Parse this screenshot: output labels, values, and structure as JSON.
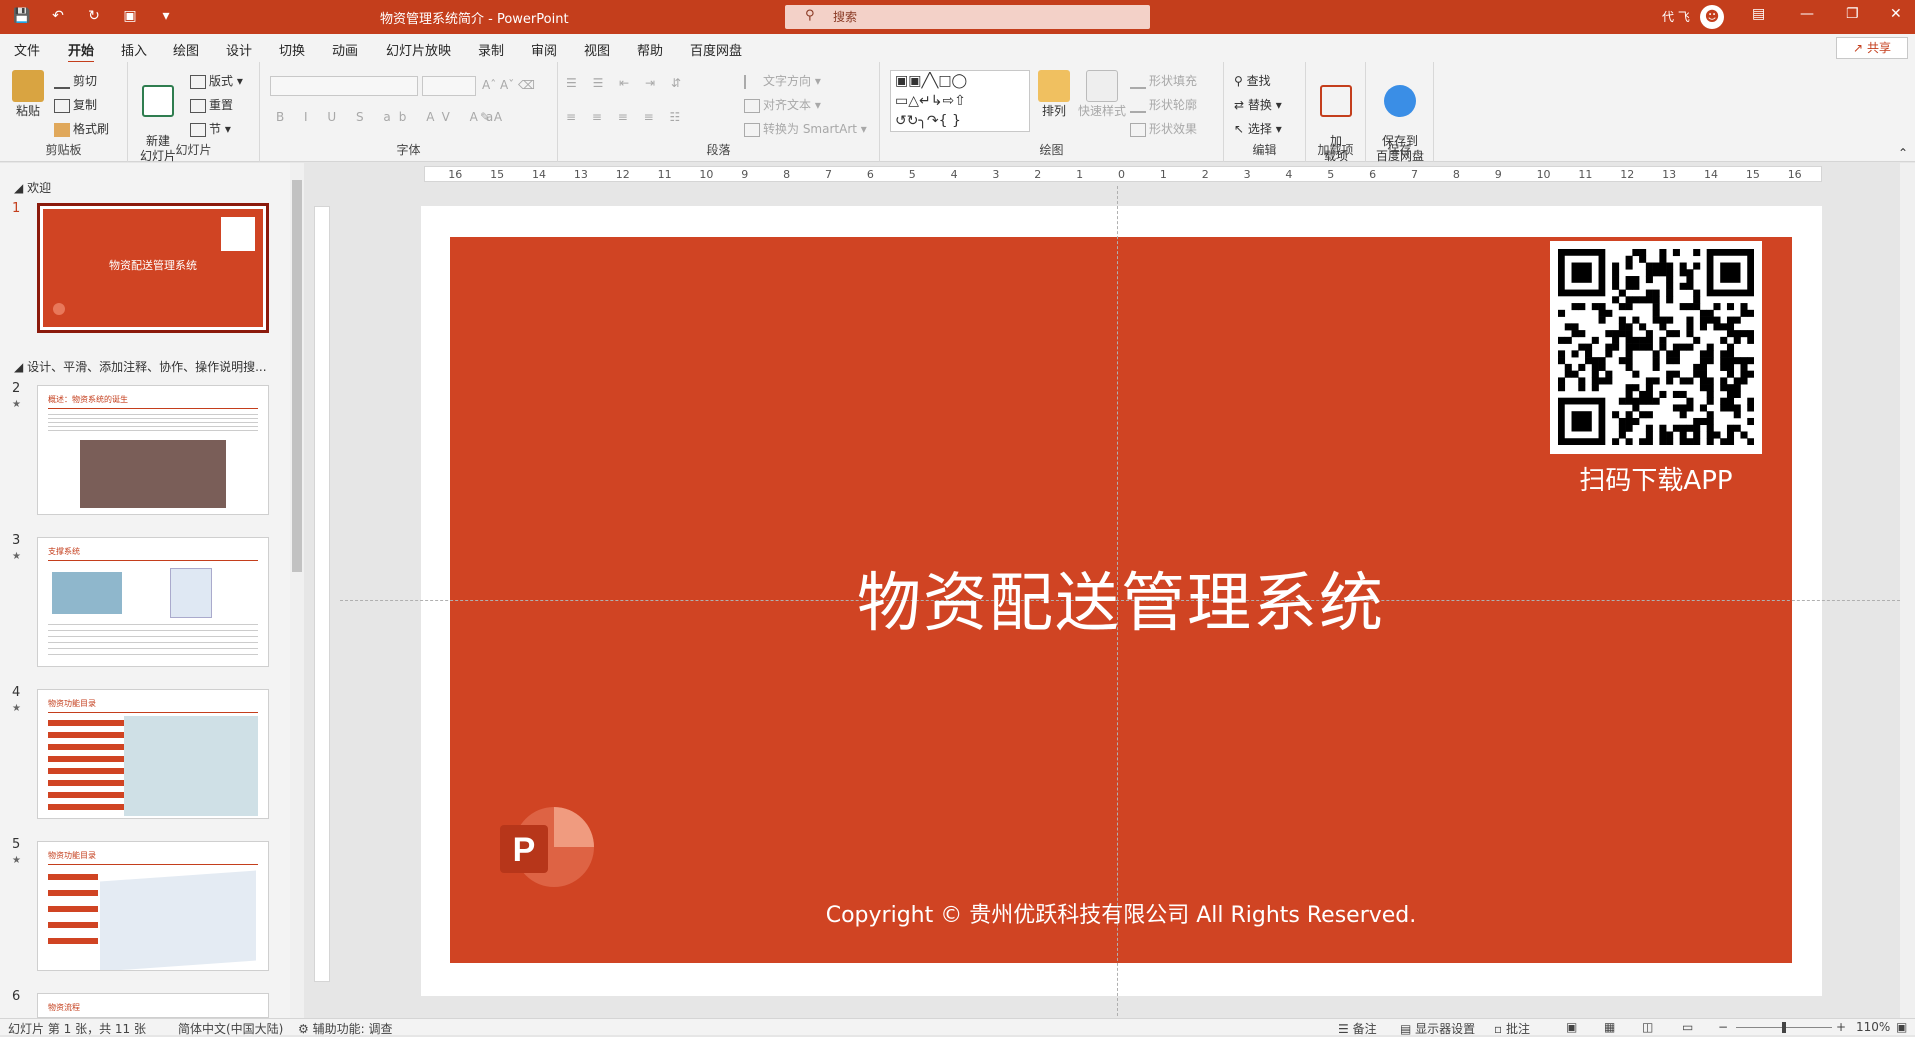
{
  "window": {
    "title": "物资管理系统简介 - PowerPoint",
    "user": "代 飞"
  },
  "search": {
    "placeholder": "搜索"
  },
  "tabs": [
    "文件",
    "开始",
    "插入",
    "绘图",
    "设计",
    "切换",
    "动画",
    "幻灯片放映",
    "录制",
    "审阅",
    "视图",
    "帮助",
    "百度网盘"
  ],
  "share": "共享",
  "ribbon": {
    "clipboard": {
      "paste": "粘贴",
      "cut": "剪切",
      "copy": "复制",
      "format_painter": "格式刷",
      "label": "剪贴板"
    },
    "slides": {
      "new_slide": "新建\n幻灯片",
      "layout": "版式",
      "reset": "重置",
      "section": "节",
      "label": "幻灯片"
    },
    "font": {
      "label": "字体"
    },
    "paragraph": {
      "text_direction": "文字方向",
      "align_text": "对齐文本",
      "smartart": "转换为 SmartArt",
      "label": "段落"
    },
    "drawing": {
      "arrange": "排列",
      "quick_styles": "快速样式",
      "shape_fill": "形状填充",
      "shape_outline": "形状轮廓",
      "shape_effects": "形状效果",
      "label": "绘图"
    },
    "editing": {
      "find": "查找",
      "replace": "替换",
      "select": "选择",
      "label": "编辑"
    },
    "addins": {
      "addins": "加\n载项",
      "label": "加载项"
    },
    "save": {
      "save_baidu": "保存到\n百度网盘",
      "label": "保存"
    }
  },
  "sections": [
    {
      "name": "欢迎"
    },
    {
      "name": "设计、平滑、添加注释、协作、操作说明搜..."
    }
  ],
  "thumbnails": [
    {
      "num": "1",
      "title": "物资配送管理系统"
    },
    {
      "num": "2",
      "title": "概述：物资系统的诞生"
    },
    {
      "num": "3",
      "title": "支撑系统"
    },
    {
      "num": "4",
      "title": "物资功能目录"
    },
    {
      "num": "5",
      "title": "物资功能目录"
    },
    {
      "num": "6",
      "title": "物资流程"
    }
  ],
  "slide": {
    "title": "物资配送管理系统",
    "qr_caption": "扫码下载APP",
    "copyright": "Copyright © 贵州优跃科技有限公司 All Rights Reserved.",
    "bg_color": "#d04423"
  },
  "ruler": {
    "h_ticks": [
      "16",
      "15",
      "14",
      "13",
      "12",
      "11",
      "10",
      "9",
      "8",
      "7",
      "6",
      "5",
      "4",
      "3",
      "2",
      "1",
      "0",
      "1",
      "2",
      "3",
      "4",
      "5",
      "6",
      "7",
      "8",
      "9",
      "10",
      "11",
      "12",
      "13",
      "14",
      "15",
      "16"
    ]
  },
  "status": {
    "slide_info": "幻灯片 第 1 张，共 11 张",
    "language": "简体中文(中国大陆)",
    "accessibility": "辅助功能: 调查",
    "notes": "备注",
    "display_settings": "显示器设置",
    "comments": "批注",
    "zoom": "110%"
  }
}
